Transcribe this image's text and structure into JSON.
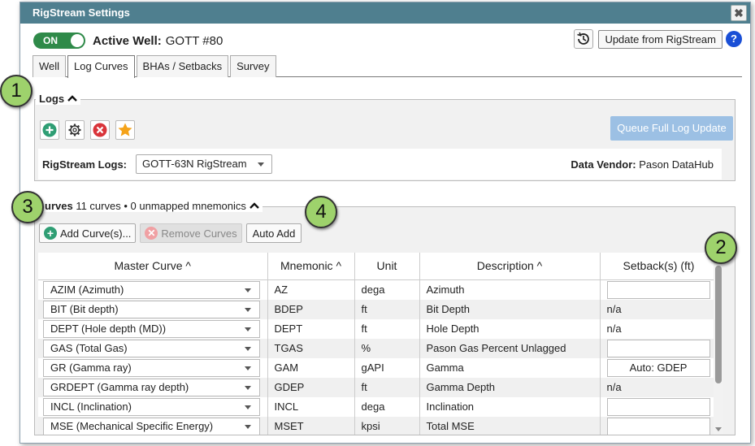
{
  "dialog": {
    "title": "RigStream Settings",
    "close_label": "✖"
  },
  "topbar": {
    "toggle_label": "ON",
    "active_well_label": "Active Well:",
    "active_well_value": "GOTT #80",
    "update_label": "Update from RigStream",
    "help_label": "?"
  },
  "tabs": [
    {
      "label": "Well"
    },
    {
      "label": "Log Curves"
    },
    {
      "label": "BHAs / Setbacks"
    },
    {
      "label": "Survey"
    }
  ],
  "logs": {
    "legend": "Logs",
    "queue_label": "Queue Full Log Update",
    "rigstream_label": "RigStream Logs:",
    "rigstream_value": "GOTT-63N RigStream",
    "vendor_label": "Data Vendor:",
    "vendor_value": "Pason DataHub"
  },
  "curves": {
    "legend": "urves",
    "count_text": "11 curves",
    "unmapped_text": "0 unmapped mnemonics",
    "add_label": "Add Curve(s)...",
    "remove_label": "Remove Curves",
    "auto_add_label": "Auto Add",
    "columns": {
      "master": "Master Curve",
      "mnemonic": "Mnemonic",
      "unit": "Unit",
      "description": "Description",
      "setback": "Setback(s) (ft)"
    },
    "rows": [
      {
        "master": "AZIM (Azimuth)",
        "mnemonic": "AZ",
        "unit": "dega",
        "description": "Azimuth",
        "setback": ""
      },
      {
        "master": "BIT (Bit depth)",
        "mnemonic": "BDEP",
        "unit": "ft",
        "description": "Bit Depth",
        "setback": "n/a"
      },
      {
        "master": "DEPT (Hole depth (MD))",
        "mnemonic": "DEPT",
        "unit": "ft",
        "description": "Hole Depth",
        "setback": "n/a"
      },
      {
        "master": "GAS (Total Gas)",
        "mnemonic": "TGAS",
        "unit": "%",
        "description": "Pason Gas Percent Unlagged",
        "setback": ""
      },
      {
        "master": "GR (Gamma ray)",
        "mnemonic": "GAM",
        "unit": "gAPI",
        "description": "Gamma",
        "setback": "Auto: GDEP"
      },
      {
        "master": "GRDEPT (Gamma ray depth)",
        "mnemonic": "GDEP",
        "unit": "ft",
        "description": "Gamma Depth",
        "setback": "n/a"
      },
      {
        "master": "INCL (Inclination)",
        "mnemonic": "INCL",
        "unit": "dega",
        "description": "Inclination",
        "setback": ""
      },
      {
        "master": "MSE (Mechanical Specific Energy)",
        "mnemonic": "MSET",
        "unit": "kpsi",
        "description": "Total MSE",
        "setback": ""
      }
    ]
  },
  "callouts": [
    "1",
    "2",
    "3",
    "4"
  ],
  "colors": {
    "titlebar": "#4f7f8f",
    "toggle_on": "#2f8a49",
    "queue_disabled": "#9cc0e4",
    "callout": "#9ed26c"
  }
}
